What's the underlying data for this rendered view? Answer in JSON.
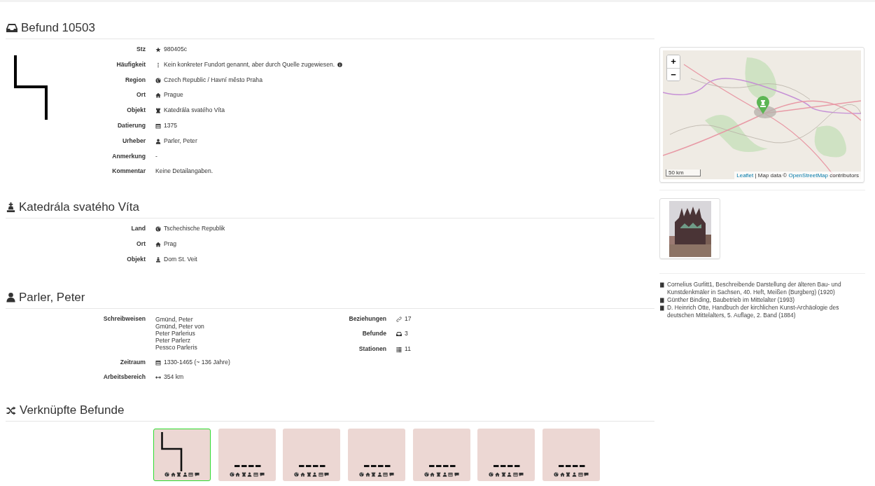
{
  "finding": {
    "title": "Befund 10503",
    "fields": [
      {
        "kind": "code",
        "label": "Stz",
        "value": "980405c"
      },
      {
        "kind": "frequency",
        "label": "Häufigkeit",
        "value": "Kein konkreter Fundort genannt, aber durch Quelle zugewiesen.",
        "info": true
      },
      {
        "kind": "region",
        "label": "Region",
        "value": "Czech Republic / Havní město Praha"
      },
      {
        "kind": "town",
        "label": "Ort",
        "value": "Prague"
      },
      {
        "kind": "object",
        "label": "Objekt",
        "value": "Katedrála svatého Víta"
      },
      {
        "kind": "date",
        "label": "Datierung",
        "value": "1375"
      },
      {
        "kind": "person",
        "label": "Urheber",
        "value": "Parler, Peter"
      },
      {
        "kind": "plain",
        "label": "Anmerkung",
        "value": "-"
      },
      {
        "kind": "plain",
        "label": "Kommentar",
        "value": "Keine Detailangaben."
      }
    ]
  },
  "object": {
    "title": "Katedrála svatého Víta",
    "fields": [
      {
        "kind": "region",
        "label": "Land",
        "value": "Tschechische Republik"
      },
      {
        "kind": "town",
        "label": "Ort",
        "value": "Prag"
      },
      {
        "kind": "monument",
        "label": "Objekt",
        "value": "Dom St. Veit"
      }
    ]
  },
  "person": {
    "title": "Parler, Peter",
    "fields": [
      {
        "kind": "plain",
        "label": "Schreibweisen",
        "values": [
          "Gmünd, Peter",
          "Gmünd, Peter von",
          "Peter Parlerius",
          "Peter Parlerz",
          "Pessco Parleris"
        ]
      },
      {
        "kind": "date",
        "label": "Zeitraum",
        "value": "1330-1465 (~ 136 Jahre)"
      },
      {
        "kind": "distance",
        "label": "Arbeitsbereich",
        "value": "354 km"
      }
    ],
    "stats": [
      {
        "kind": "relations",
        "label": "Beziehungen",
        "value": "17"
      },
      {
        "kind": "findings",
        "label": "Befunde",
        "value": "3"
      },
      {
        "kind": "stations",
        "label": "Stationen",
        "value": "11"
      }
    ]
  },
  "linked": {
    "title": "Verknüpfte Befunde",
    "items": [
      {
        "kind": "glyph",
        "selected": true
      },
      {
        "kind": "dashes",
        "selected": false
      },
      {
        "kind": "dashes",
        "selected": false
      },
      {
        "kind": "dashes",
        "selected": false
      },
      {
        "kind": "dashes",
        "selected": false
      },
      {
        "kind": "dashes",
        "selected": false
      },
      {
        "kind": "dashes",
        "selected": false
      }
    ]
  },
  "map": {
    "zoom_in": "+",
    "zoom_out": "−",
    "scale": "50 km",
    "attribution": [
      {
        "kind": "link",
        "text": "Leaflet"
      },
      {
        "kind": "text",
        "text": "| Map data ©"
      },
      {
        "kind": "link",
        "text": "OpenStreetMap"
      },
      {
        "kind": "text",
        "text": "contributors"
      }
    ]
  },
  "photo": {
    "kind": "picture"
  },
  "references": [
    "Cornelius Gurlitt1, Beschreibende Darstellung der älteren Bau- und Kunstdenkmäler in Sachsen, 40. Heft, Meißen (Burgberg) (1920)",
    "Günther Binding, Baubetrieb im Mittelalter (1993)",
    "D. Heinrich Otte, Handbuch der kirchlichen Kunst-Archäologie des deutschen Mittelalters, 5. Auflage, 2. Band (1884)"
  ]
}
